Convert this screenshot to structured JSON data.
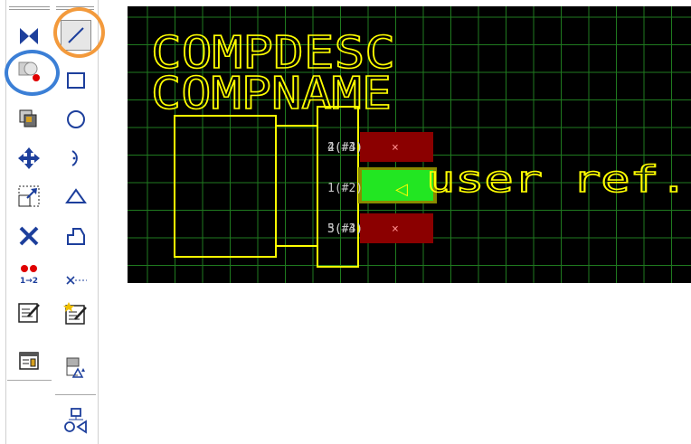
{
  "toolbar": {
    "left_column": [
      {
        "icon": "swap-icon"
      },
      {
        "icon": "shapes-with-dot-icon",
        "highlight": "blue"
      },
      {
        "icon": "copy-icon"
      },
      {
        "icon": "move-arrows-icon"
      },
      {
        "icon": "resize-icon"
      },
      {
        "icon": "delete-x-icon"
      },
      {
        "icon": "renumber-pins-icon",
        "label": "1→2"
      },
      {
        "icon": "edit-text-icon"
      },
      {
        "icon": "properties-icon"
      }
    ],
    "right_column": [
      {
        "icon": "line-icon",
        "highlight": "orange",
        "selected": true
      },
      {
        "icon": "rectangle-icon"
      },
      {
        "icon": "circle-icon"
      },
      {
        "icon": "arc-icon"
      },
      {
        "icon": "triangle-icon"
      },
      {
        "icon": "polygon-icon"
      },
      {
        "icon": "pin-line-icon"
      },
      {
        "icon": "edit-text-sparkle-icon"
      },
      {
        "icon": "component-wizard-icon"
      },
      {
        "icon": "shapes-group-icon"
      }
    ],
    "highlight_colors": {
      "blue": "#3b7fd6",
      "orange": "#f39a3c"
    }
  },
  "canvas": {
    "background": "#000000",
    "grid_color": "#1f7a1f",
    "outline_color": "#ffff00",
    "compdesc_text": "COMPDESC",
    "compname_text": "COMPNAME",
    "user_ref_text": "user ref.",
    "pins": [
      {
        "label": "2(#3)",
        "overlap_label": "4(#4)",
        "marker": "×",
        "pad_color": "#8b0000",
        "selected": false
      },
      {
        "label": "1(#2)",
        "marker": "◁",
        "pad_color": "#22e622",
        "selected": true
      },
      {
        "label": "3(#3)",
        "overlap_label": "5(#4)",
        "marker": "×",
        "pad_color": "#8b0000",
        "selected": false
      }
    ],
    "pin_label_color": "#c8c8c8",
    "pin_marker_color": "#ff8c8c",
    "selected_marker_color": "#ffff00"
  }
}
